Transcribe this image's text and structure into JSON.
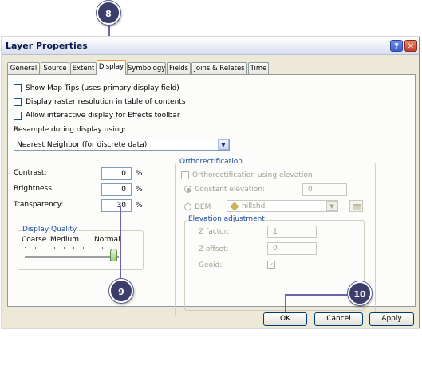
{
  "window": {
    "title": "Layer Properties",
    "help_glyph": "?",
    "close_glyph": "✕"
  },
  "tabs": [
    {
      "label": "General"
    },
    {
      "label": "Source"
    },
    {
      "label": "Extent"
    },
    {
      "label": "Display",
      "active": true
    },
    {
      "label": "Symbology"
    },
    {
      "label": "Fields"
    },
    {
      "label": "Joins & Relates"
    },
    {
      "label": "Time"
    }
  ],
  "display": {
    "options": [
      {
        "label": "Show Map Tips (uses primary display field)",
        "checked": false
      },
      {
        "label": "Display raster resolution in table of contents",
        "checked": false
      },
      {
        "label": "Allow interactive display for Effects toolbar",
        "checked": false
      }
    ],
    "resample_label": "Resample during display using:",
    "resample_value": "Nearest Neighbor (for discrete data)",
    "contrast_label": "Contrast:",
    "contrast_value": "0",
    "brightness_label": "Brightness:",
    "brightness_value": "0",
    "transparency_label": "Transparency:",
    "transparency_value": "30",
    "percent": "%",
    "quality": {
      "title": "Display Quality",
      "coarse": "Coarse",
      "medium": "Medium",
      "normal": "Normal"
    }
  },
  "ortho": {
    "title": "Orthorectification",
    "use_elevation_label": "Orthorectification using elevation",
    "constant_label": "Constant elevation:",
    "constant_value": "0",
    "dem_label": "DEM",
    "dem_value": "hillshd",
    "elevation_adjustment": {
      "title": "Elevation adjustment",
      "zfactor_label": "Z factor:",
      "zfactor_value": "1",
      "zoffset_label": "Z offset:",
      "zoffset_value": "0",
      "geoid_label": "Geoid:"
    }
  },
  "buttons": {
    "ok": "OK",
    "cancel": "Cancel",
    "apply": "Apply"
  },
  "callouts": {
    "c8": "8",
    "c9": "9",
    "c10": "10"
  },
  "colors": {
    "callout": "#3b3e6b",
    "leader_line": "#6e63b0",
    "active_tab_accent": "#e69a3d"
  }
}
